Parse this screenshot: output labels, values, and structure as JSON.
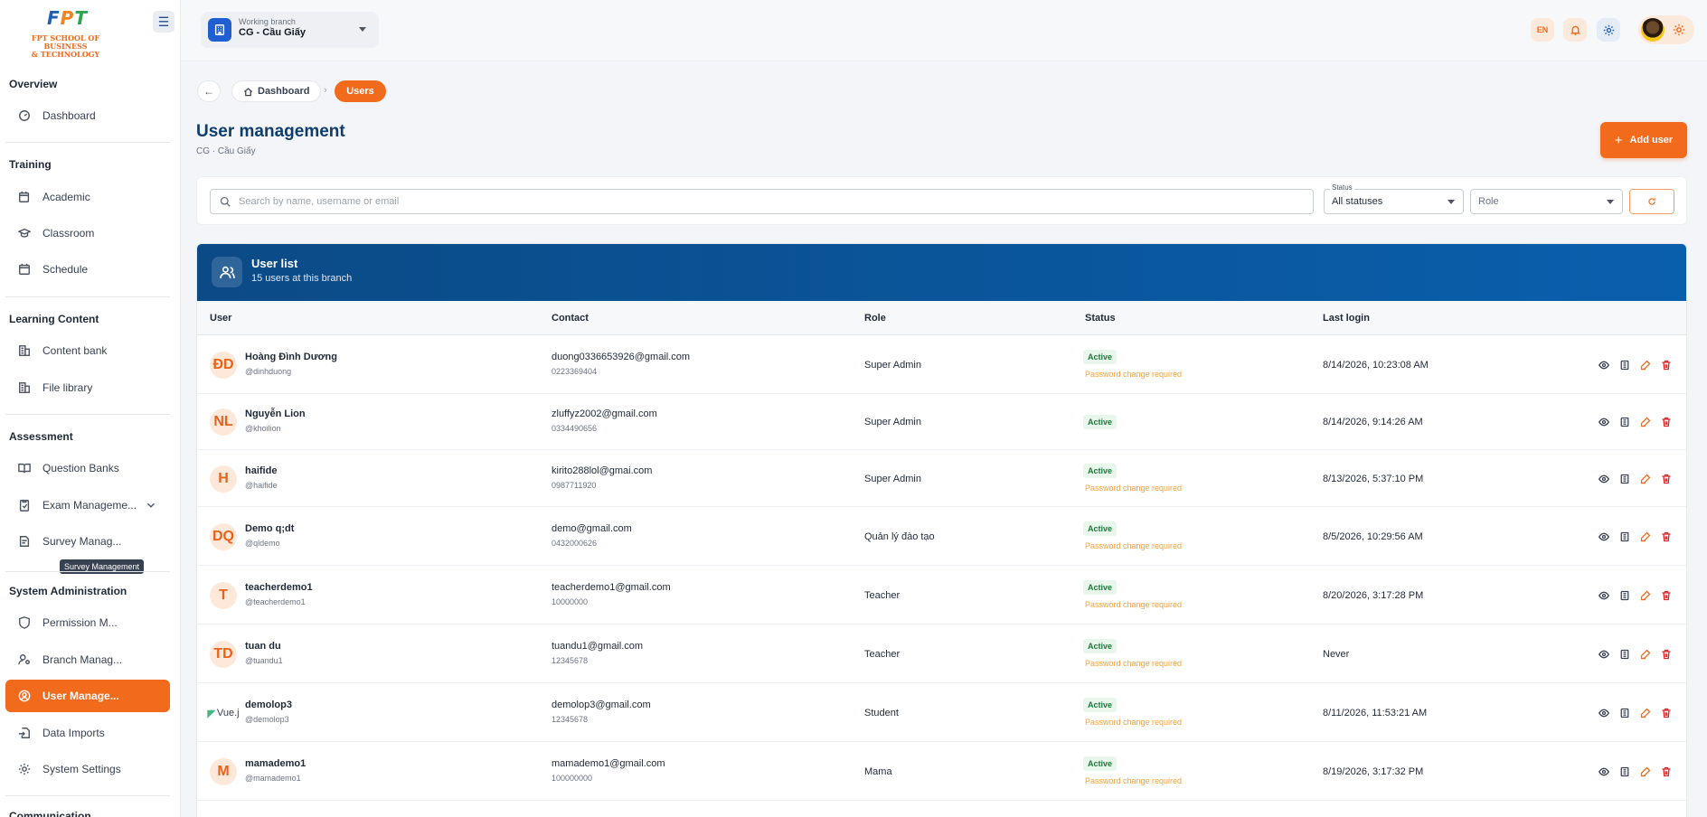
{
  "logo": {
    "brand": "FPT",
    "subtitle_line1": "FPT SCHOOL OF BUSINESS",
    "subtitle_line2": "& TECHNOLOGY"
  },
  "sidebar": {
    "sections": [
      "Overview",
      "Training",
      "Learning Content",
      "Assessment",
      "System Administration",
      "Communication"
    ],
    "items": [
      {
        "label": "Dashboard",
        "icon": "dashboard-icon"
      },
      {
        "label": "Academic",
        "icon": "calendar-icon"
      },
      {
        "label": "Classroom",
        "icon": "graduation-cap-icon"
      },
      {
        "label": "Schedule",
        "icon": "calendar-icon"
      },
      {
        "label": "Content bank",
        "icon": "building-icon"
      },
      {
        "label": "File library",
        "icon": "building-icon"
      },
      {
        "label": "Question Banks",
        "icon": "book-icon"
      },
      {
        "label": "Exam Manageme...",
        "icon": "clipboard-check-icon"
      },
      {
        "label": "Survey Manag...",
        "icon": "document-icon"
      },
      {
        "label": "Permission M...",
        "icon": "shield-icon"
      },
      {
        "label": "Branch Manag...",
        "icon": "user-location-icon"
      },
      {
        "label": "User Manage...",
        "icon": "user-circle-icon"
      },
      {
        "label": "Data Imports",
        "icon": "file-import-icon"
      },
      {
        "label": "System Settings",
        "icon": "gear-icon"
      }
    ],
    "tooltip": "Survey Management"
  },
  "topbar": {
    "branch_label": "Working branch",
    "branch_value": "CG - Cầu Giấy",
    "lang": "EN"
  },
  "breadcrumb": {
    "home": "Dashboard",
    "current": "Users"
  },
  "page": {
    "title": "User management",
    "subtitle": "CG · Cầu Giấy",
    "add_button": "Add user"
  },
  "filters": {
    "search_placeholder": "Search by name, username or email",
    "status_label": "Status",
    "status_value": "All statuses",
    "role_placeholder": "Role"
  },
  "table": {
    "title": "User list",
    "subtitle": "15 users at this branch",
    "columns": [
      "User",
      "Contact",
      "Role",
      "Status",
      "Last login"
    ],
    "rows": [
      {
        "initials": "ĐD",
        "name": "Hoàng Đình Dương",
        "handle": "@dinhduong",
        "email": "duong0336653926@gmail.com",
        "phone": "0223369404",
        "role": "Super Admin",
        "status": "Active",
        "note": "Password change required",
        "last_login": "8/14/2026, 10:23:08 AM"
      },
      {
        "initials": "NL",
        "name": "Nguyễn Lion",
        "handle": "@khoilion",
        "email": "zluffyz2002@gmail.com",
        "phone": "0334490656",
        "role": "Super Admin",
        "status": "Active",
        "note": "",
        "last_login": "8/14/2026, 9:14:26 AM"
      },
      {
        "initials": "H",
        "name": "haifide",
        "handle": "@haifide",
        "email": "kirito288lol@gmai.com",
        "phone": "0987711920",
        "role": "Super Admin",
        "status": "Active",
        "note": "Password change required",
        "last_login": "8/13/2026, 5:37:10 PM"
      },
      {
        "initials": "DQ",
        "name": "Demo q;dt",
        "handle": "@qldemo",
        "email": "demo@gmail.com",
        "phone": "0432000626",
        "role": "Quản lý đào tạo",
        "status": "Active",
        "note": "Password change required",
        "last_login": "8/5/2026, 10:29:56 AM"
      },
      {
        "initials": "T",
        "name": "teacherdemo1",
        "handle": "@teacherdemo1",
        "email": "teacherdemo1@gmail.com",
        "phone": "10000000",
        "role": "Teacher",
        "status": "Active",
        "note": "Password change required",
        "last_login": "8/20/2026, 3:17:28 PM"
      },
      {
        "initials": "TD",
        "name": "tuan du",
        "handle": "@tuandu1",
        "email": "tuandu1@gmail.com",
        "phone": "12345678",
        "role": "Teacher",
        "status": "Active",
        "note": "Password change required",
        "last_login": "Never"
      },
      {
        "initials": "Vue.j",
        "name": "demolop3",
        "handle": "@demolop3",
        "email": "demolop3@gmail.com",
        "phone": "12345678",
        "role": "Student",
        "status": "Active",
        "note": "Password change required",
        "last_login": "8/11/2026, 11:53:21 AM"
      },
      {
        "initials": "M",
        "name": "mamademo1",
        "handle": "@mamademo1",
        "email": "mamademo1@gmail.com",
        "phone": "100000000",
        "role": "Mama",
        "status": "Active",
        "note": "Password change required",
        "last_login": "8/19/2026, 3:17:32 PM"
      }
    ]
  },
  "colors": {
    "accent": "#f26a1b",
    "header_blue": "#0b4a86",
    "title_blue": "#0f3d6e",
    "active_green": "#1e7a3a",
    "warning": "#f5a13a",
    "delete_red": "#dc2626"
  }
}
